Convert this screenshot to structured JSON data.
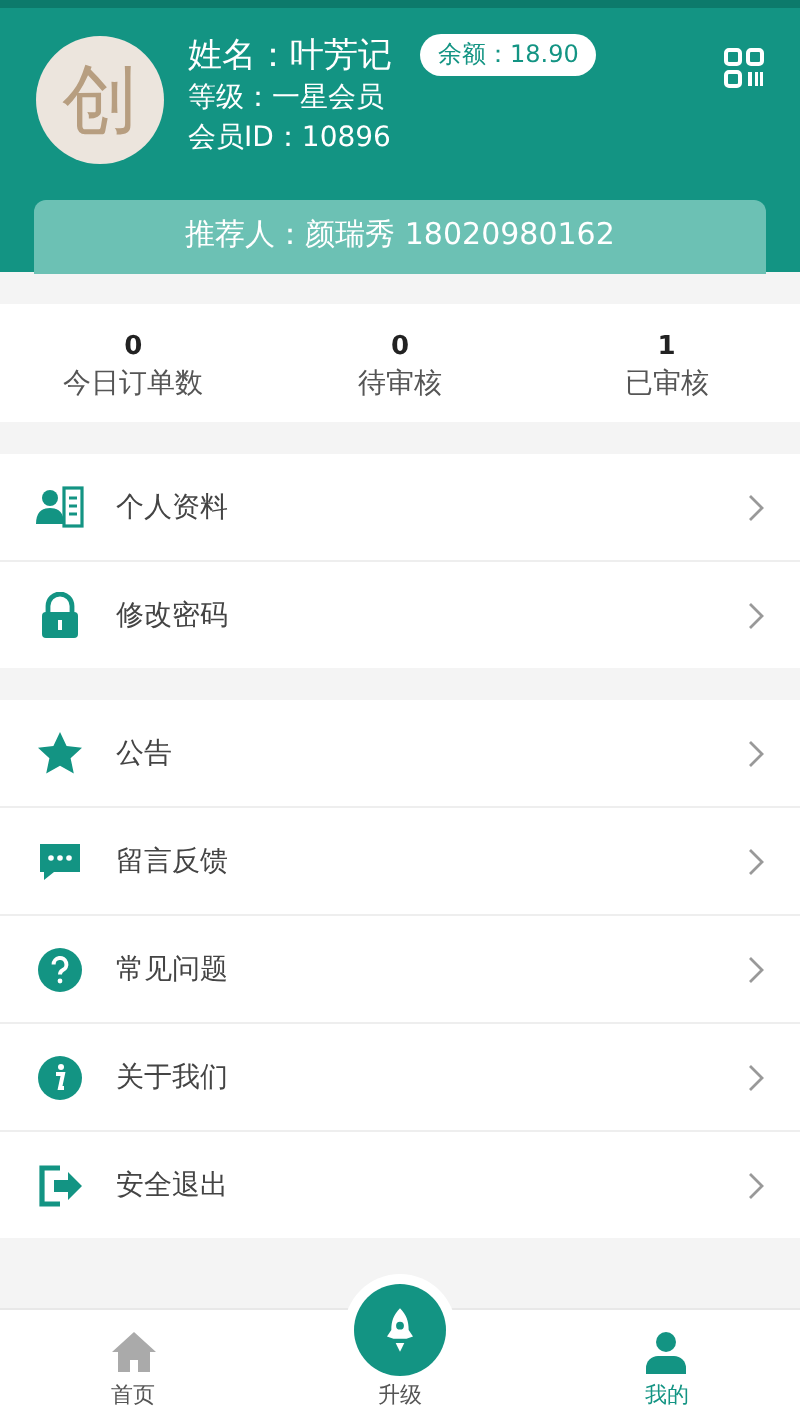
{
  "profile": {
    "avatar_text": "创",
    "name": "姓名：叶芳记",
    "balance": "余额：18.90",
    "level": "等级：一星会员",
    "member_id": "会员ID：10896",
    "referrer": "推荐人：颜瑞秀  18020980162"
  },
  "stats": [
    {
      "value": "0",
      "label": "今日订单数"
    },
    {
      "value": "0",
      "label": "待审核"
    },
    {
      "value": "1",
      "label": "已审核"
    }
  ],
  "menu_groups": [
    [
      {
        "kind": "profile",
        "label": "个人资料"
      },
      {
        "kind": "lock",
        "label": "修改密码"
      }
    ],
    [
      {
        "kind": "star",
        "label": "公告"
      },
      {
        "kind": "chat",
        "label": "留言反馈"
      },
      {
        "kind": "help",
        "label": "常见问题"
      },
      {
        "kind": "info",
        "label": "关于我们"
      },
      {
        "kind": "logout",
        "label": "安全退出"
      }
    ]
  ],
  "tabs": [
    {
      "kind": "home",
      "label": "首页",
      "selected": false
    },
    {
      "kind": "upgrade",
      "label": "升级",
      "selected": false
    },
    {
      "kind": "me",
      "label": "我的",
      "selected": true
    }
  ]
}
